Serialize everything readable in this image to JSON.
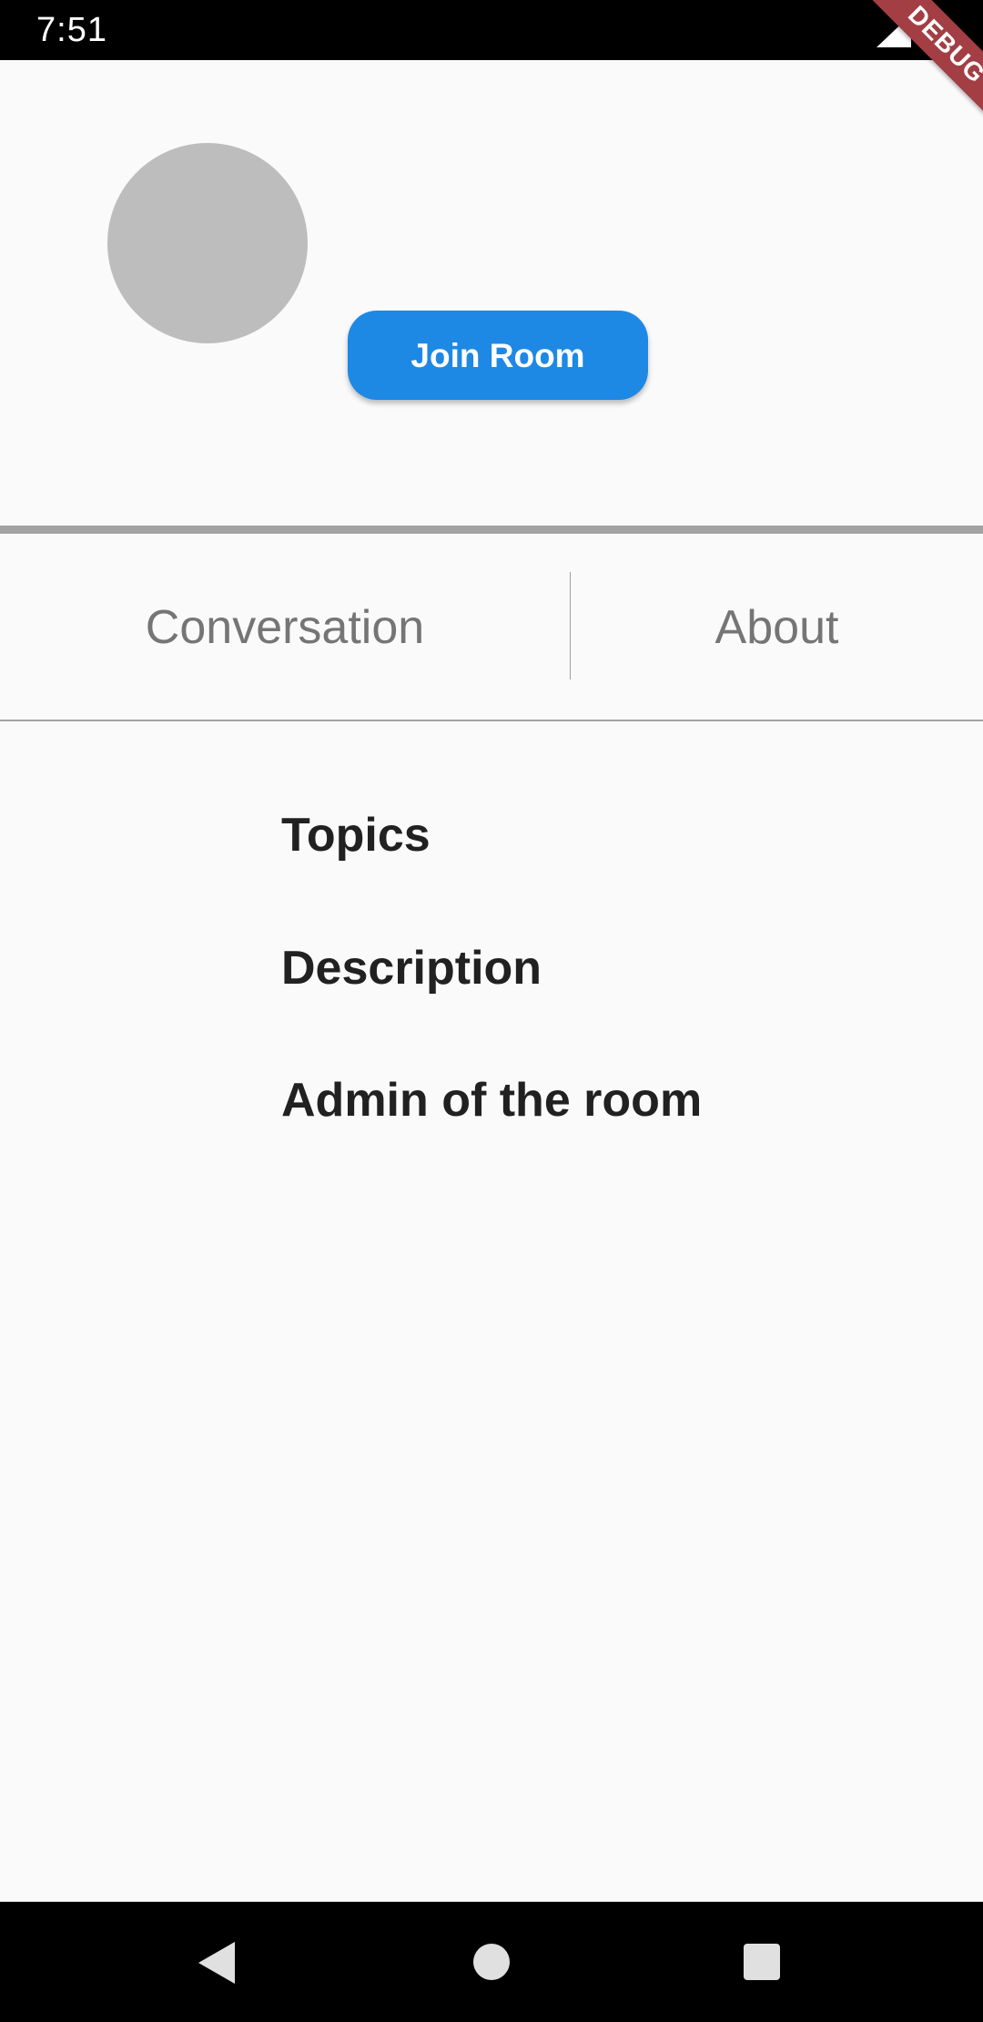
{
  "status_bar": {
    "time": "7:51",
    "signal_icon": "signal-icon",
    "battery_icon": "battery-icon"
  },
  "debug_banner": {
    "label": "DEBUG",
    "color": "#a33e45"
  },
  "header": {
    "avatar_color": "#bdbdbd",
    "join_button_label": "Join Room",
    "join_button_color": "#1e88e5"
  },
  "tabs": [
    {
      "label": "Conversation"
    },
    {
      "label": "About"
    }
  ],
  "about": {
    "sections": [
      {
        "heading": "Topics"
      },
      {
        "heading": "Description"
      },
      {
        "heading": "Admin of the room"
      }
    ]
  },
  "nav_bar": {
    "back_icon": "back-triangle-icon",
    "home_icon": "home-circle-icon",
    "recents_icon": "recents-square-icon"
  }
}
